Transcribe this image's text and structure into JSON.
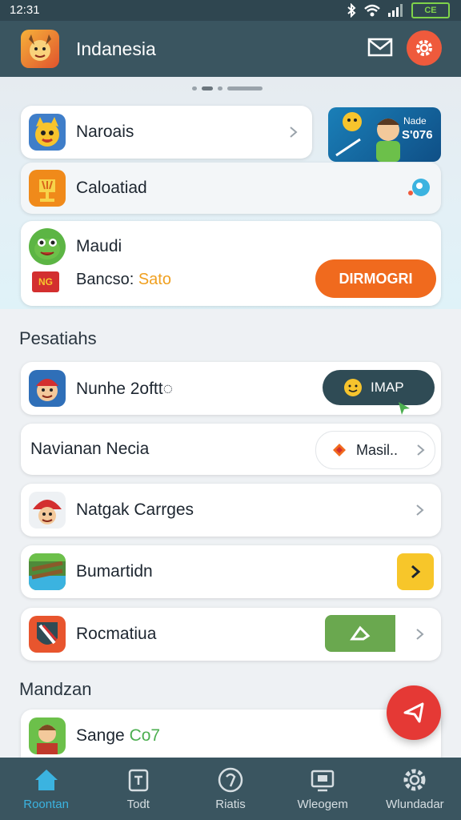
{
  "status": {
    "time": "12:31",
    "battery": "CE"
  },
  "appbar": {
    "title": "Indanesia"
  },
  "featured": {
    "card1": {
      "label": "Naroais"
    },
    "card2": {
      "label": "Caloatiad"
    },
    "card3": {
      "label": "Maudi",
      "sublabel_prefix": "Bancso: ",
      "sublabel_value": "Sato",
      "button": "DIRMOGRI"
    },
    "banner": {
      "line1": "Nade",
      "line2": "S'076"
    }
  },
  "sections": {
    "section1": "Pesatiahs",
    "section2": "Mandzan"
  },
  "list": {
    "row1": {
      "label": "Nunhe 2oftt◌",
      "button": "IMAP"
    },
    "row2": {
      "label": "Navianan Necia",
      "button": "Masil.."
    },
    "row3": {
      "label": "Natgak Carrges"
    },
    "row4": {
      "label": "Bumartidn"
    },
    "row5": {
      "label": "Rocmatiua"
    },
    "row6": {
      "label_prefix": "Sange ",
      "label_value": "Co7"
    }
  },
  "nav": [
    {
      "label": "Roontan"
    },
    {
      "label": "Todt"
    },
    {
      "label": "Riatis"
    },
    {
      "label": "Wleogem"
    },
    {
      "label": "Wlundadar"
    }
  ],
  "colors": {
    "accent": "#ef5a3c",
    "bar": "#3a5560",
    "orange_btn": "#f06a1e",
    "dark_btn": "#2f4b55",
    "yellow": "#f7c62a",
    "green": "#6aa84f",
    "active_nav": "#3bb3e0"
  }
}
